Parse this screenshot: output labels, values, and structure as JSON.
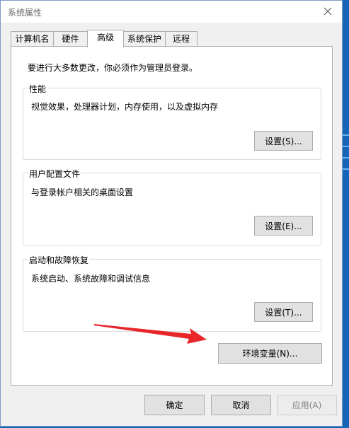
{
  "window": {
    "title": "系统属性"
  },
  "tabs": [
    {
      "label": "计算机名",
      "active": false
    },
    {
      "label": "硬件",
      "active": false
    },
    {
      "label": "高级",
      "active": true
    },
    {
      "label": "系统保护",
      "active": false
    },
    {
      "label": "远程",
      "active": false
    }
  ],
  "panel": {
    "notice": "要进行大多数更改，你必须作为管理员登录。",
    "performance": {
      "title": "性能",
      "description": "视觉效果，处理器计划，内存使用，以及虚拟内存",
      "button": "设置(S)..."
    },
    "profiles": {
      "title": "用户配置文件",
      "description": "与登录帐户相关的桌面设置",
      "button": "设置(E)..."
    },
    "startup": {
      "title": "启动和故障恢复",
      "description": "系统启动、系统故障和调试信息",
      "button": "设置(T)..."
    },
    "env_button": "环境变量(N)..."
  },
  "footer": {
    "ok": "确定",
    "cancel": "取消",
    "apply": "应用(A)"
  },
  "colors": {
    "annotation_arrow": "#e8262a",
    "desktop": "#1565b8"
  }
}
